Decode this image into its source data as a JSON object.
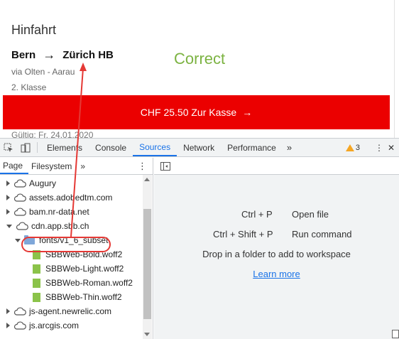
{
  "webpage": {
    "section_title": "Hinfahrt",
    "from": "Bern",
    "arrow": "→",
    "to": "Zürich HB",
    "via": "via Olten - Aarau",
    "class": "2. Klasse",
    "button_label": "CHF 25.50 Zur Kasse",
    "button_arrow": "→",
    "valid": "Gültig: Fr, 24.01.2020",
    "annotation": "Correct",
    "annotation_color": "#7cb342",
    "button_color": "#eb0000"
  },
  "devtools": {
    "tabs": [
      "Elements",
      "Console",
      "Sources",
      "Network",
      "Performance"
    ],
    "active_tab": "Sources",
    "more_tabs": "»",
    "warning_count": "3",
    "menu": "⋮",
    "close": "✕",
    "navigator": {
      "tabs": [
        "Page",
        "Filesystem"
      ],
      "more": "»",
      "menu": "⋮",
      "tree": [
        {
          "label": "Augury",
          "type": "domain",
          "expanded": false
        },
        {
          "label": "assets.adobedtm.com",
          "type": "domain",
          "expanded": false
        },
        {
          "label": "bam.nr-data.net",
          "type": "domain",
          "expanded": false
        },
        {
          "label": "cdn.app.sbb.ch",
          "type": "domain",
          "expanded": true
        },
        {
          "label": "fonts/v1_6_subset",
          "type": "folder",
          "expanded": true
        },
        {
          "label": "SBBWeb-Bold.woff2",
          "type": "file"
        },
        {
          "label": "SBBWeb-Light.woff2",
          "type": "file"
        },
        {
          "label": "SBBWeb-Roman.woff2",
          "type": "file"
        },
        {
          "label": "SBBWeb-Thin.woff2",
          "type": "file"
        },
        {
          "label": "js-agent.newrelic.com",
          "type": "domain",
          "expanded": false
        },
        {
          "label": "js.arcgis.com",
          "type": "domain",
          "expanded": false
        }
      ]
    },
    "main": {
      "shortcuts": [
        {
          "keys": "Ctrl + P",
          "action": "Open file"
        },
        {
          "keys": "Ctrl + Shift + P",
          "action": "Run command"
        }
      ],
      "drop_hint": "Drop in a folder to add to workspace",
      "learn_more": "Learn more"
    },
    "highlight_color": "#e53935"
  }
}
